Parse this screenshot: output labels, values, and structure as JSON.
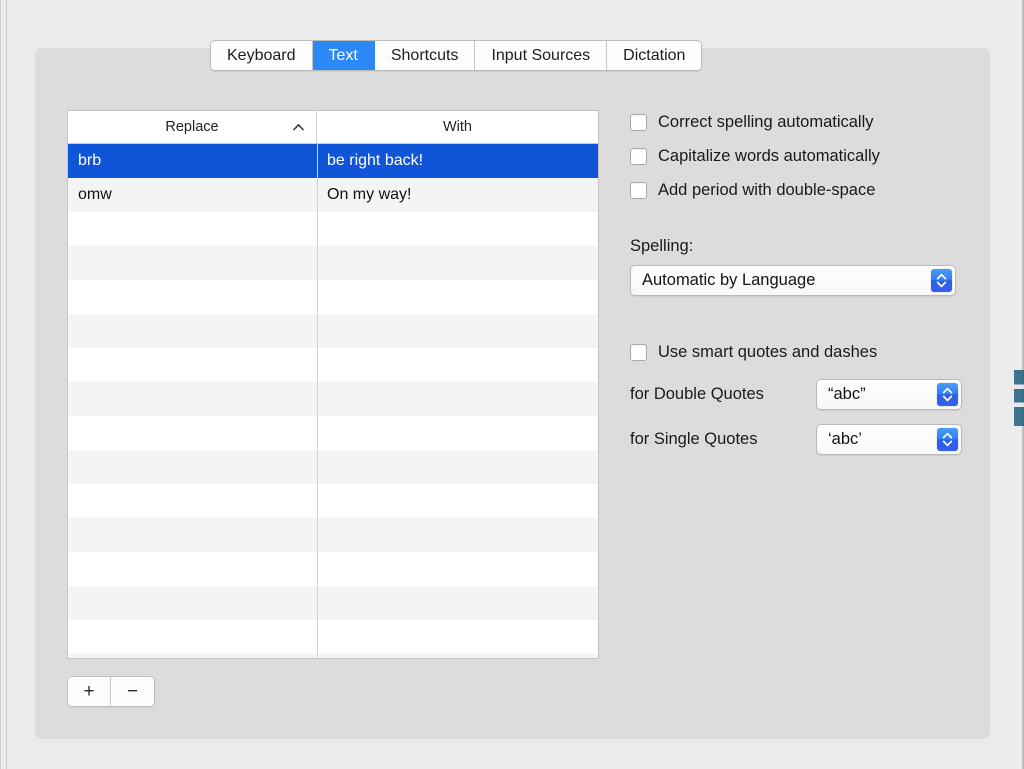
{
  "window": {
    "pane_title": "Keyboard"
  },
  "tabs": [
    {
      "label": "Keyboard",
      "name": "tab-keyboard",
      "active": false
    },
    {
      "label": "Text",
      "name": "tab-text",
      "active": true
    },
    {
      "label": "Shortcuts",
      "name": "tab-shortcuts",
      "active": false
    },
    {
      "label": "Input Sources",
      "name": "tab-input-sources",
      "active": false
    },
    {
      "label": "Dictation",
      "name": "tab-dictation",
      "active": false
    }
  ],
  "table": {
    "columns": [
      {
        "label": "Replace",
        "sort": "ascending"
      },
      {
        "label": "With",
        "sort": "none"
      }
    ],
    "rows": [
      {
        "replace": "brb",
        "with": "be right back!",
        "selected": true
      },
      {
        "replace": "omw",
        "with": "On my way!",
        "selected": false
      }
    ],
    "empty_row_count": 14,
    "selected_row_index": 0
  },
  "table_buttons": {
    "add_label": "+",
    "remove_label": "−"
  },
  "options": {
    "checkboxes": [
      {
        "label": "Correct spelling automatically",
        "checked": false
      },
      {
        "label": "Capitalize words automatically",
        "checked": false
      },
      {
        "label": "Add period with double-space",
        "checked": false
      }
    ],
    "spelling_label": "Spelling:",
    "spelling_value": "Automatic by Language",
    "smart_quotes_checkbox": {
      "label": "Use smart quotes and dashes",
      "checked": false
    },
    "double_quotes_label": "for Double Quotes",
    "double_quotes_value": "“abc”",
    "single_quotes_label": "for Single Quotes",
    "single_quotes_value": "‘abc’"
  },
  "colors": {
    "accent_blue": "#2c88f5",
    "selection_blue": "#1055d8",
    "stepper_blue": "#2f7ef3",
    "panel_bg": "#dcdcdc",
    "window_bg": "#ebebeb",
    "row_stripe": "#f4f4f4"
  }
}
